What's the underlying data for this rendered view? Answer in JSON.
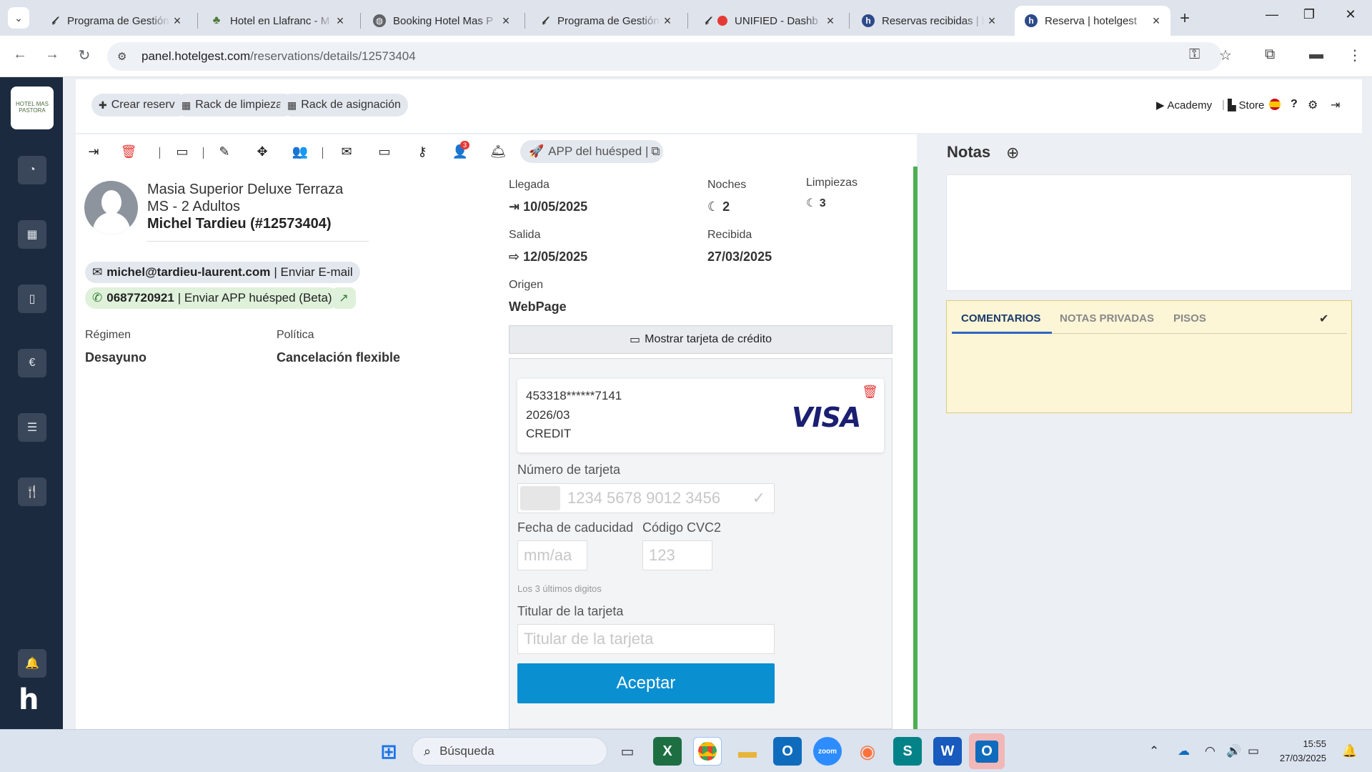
{
  "browser": {
    "tabs": [
      {
        "title": "Programa de Gestión",
        "favicon": "pen-icon"
      },
      {
        "title": "Hotel en Llafranc - M",
        "favicon": "tree-icon"
      },
      {
        "title": "Booking Hotel Mas P",
        "favicon": "globe-icon"
      },
      {
        "title": "Programa de Gestión",
        "favicon": "pen-icon"
      },
      {
        "title": "UNIFIED - Dashb",
        "favicon": "pen-icon"
      },
      {
        "title": "Reservas recibidas | h",
        "favicon": "h-icon"
      },
      {
        "title": "Reserva | hotelgest",
        "favicon": "h-icon",
        "active": true
      }
    ],
    "url_host": "panel.hotelgest.com",
    "url_path": "/reservations/details/12573404"
  },
  "sidebar": {
    "logo_text": "HOTEL MAS PASTORA",
    "items": [
      "pie-chart-icon",
      "calendar-icon",
      "file-icon",
      "euro-icon",
      "list-icon",
      "utensils-icon"
    ],
    "bell": "bell-icon",
    "brand": "h"
  },
  "topbar": {
    "crear_reserva": "Crear reserva",
    "rack_limpiezas": "Rack de limpiezas",
    "rack_asignacion": "Rack de asignación",
    "academy": "Academy",
    "store": "Store"
  },
  "toolbar": {
    "app_huesped": "APP del huésped |",
    "notifications_badge": "3"
  },
  "reservation": {
    "room_type": "Masia Superior Deluxe Terraza",
    "room_code": "MS - 2 Adultos",
    "guest_name": "Michel Tardieu (#12573404)",
    "email": "michel@tardieu-laurent.com",
    "email_action": "| Enviar E-mail",
    "phone": "0687720921",
    "phone_action": "| Enviar APP huésped (Beta)",
    "regimen_label": "Régimen",
    "regimen_value": "Desayuno",
    "politica_label": "Política",
    "politica_value": "Cancelación flexible",
    "llegada_label": "Llegada",
    "llegada_value": "10/05/2025",
    "noches_label": "Noches",
    "noches_value": "2",
    "limpiezas_label": "Limpiezas",
    "limpiezas_value": "3",
    "salida_label": "Salida",
    "salida_value": "12/05/2025",
    "recibida_label": "Recibida",
    "recibida_value": "27/03/2025",
    "origen_label": "Origen",
    "origen_value": "WebPage"
  },
  "card": {
    "toggle_label": "Mostrar tarjeta de crédito",
    "number_masked": "453318******7141",
    "expiry": "2026/03",
    "type": "CREDIT",
    "brand": "VISA",
    "numero_label": "Número de tarjeta",
    "numero_placeholder": "1234 5678 9012 3456",
    "caducidad_label": "Fecha de caducidad",
    "caducidad_placeholder": "mm/aa",
    "cvc_label": "Código CVC2",
    "cvc_placeholder": "123",
    "cvc_hint": "Los 3 últimos digitos",
    "titular_label": "Titular de la tarjeta",
    "titular_placeholder": "Titular de la tarjeta",
    "accept": "Aceptar"
  },
  "notes": {
    "title": "Notas",
    "tabs": [
      "COMENTARIOS",
      "NOTAS PRIVADAS",
      "PISOS"
    ]
  },
  "taskbar": {
    "search_placeholder": "Búsqueda",
    "time": "15:55",
    "date": "27/03/2025"
  },
  "colors": {
    "sidebar": "#1c2a40",
    "accept_button": "#0a8fd1",
    "green_bar": "#4caf50",
    "comments_bg": "#fcf5d6"
  }
}
